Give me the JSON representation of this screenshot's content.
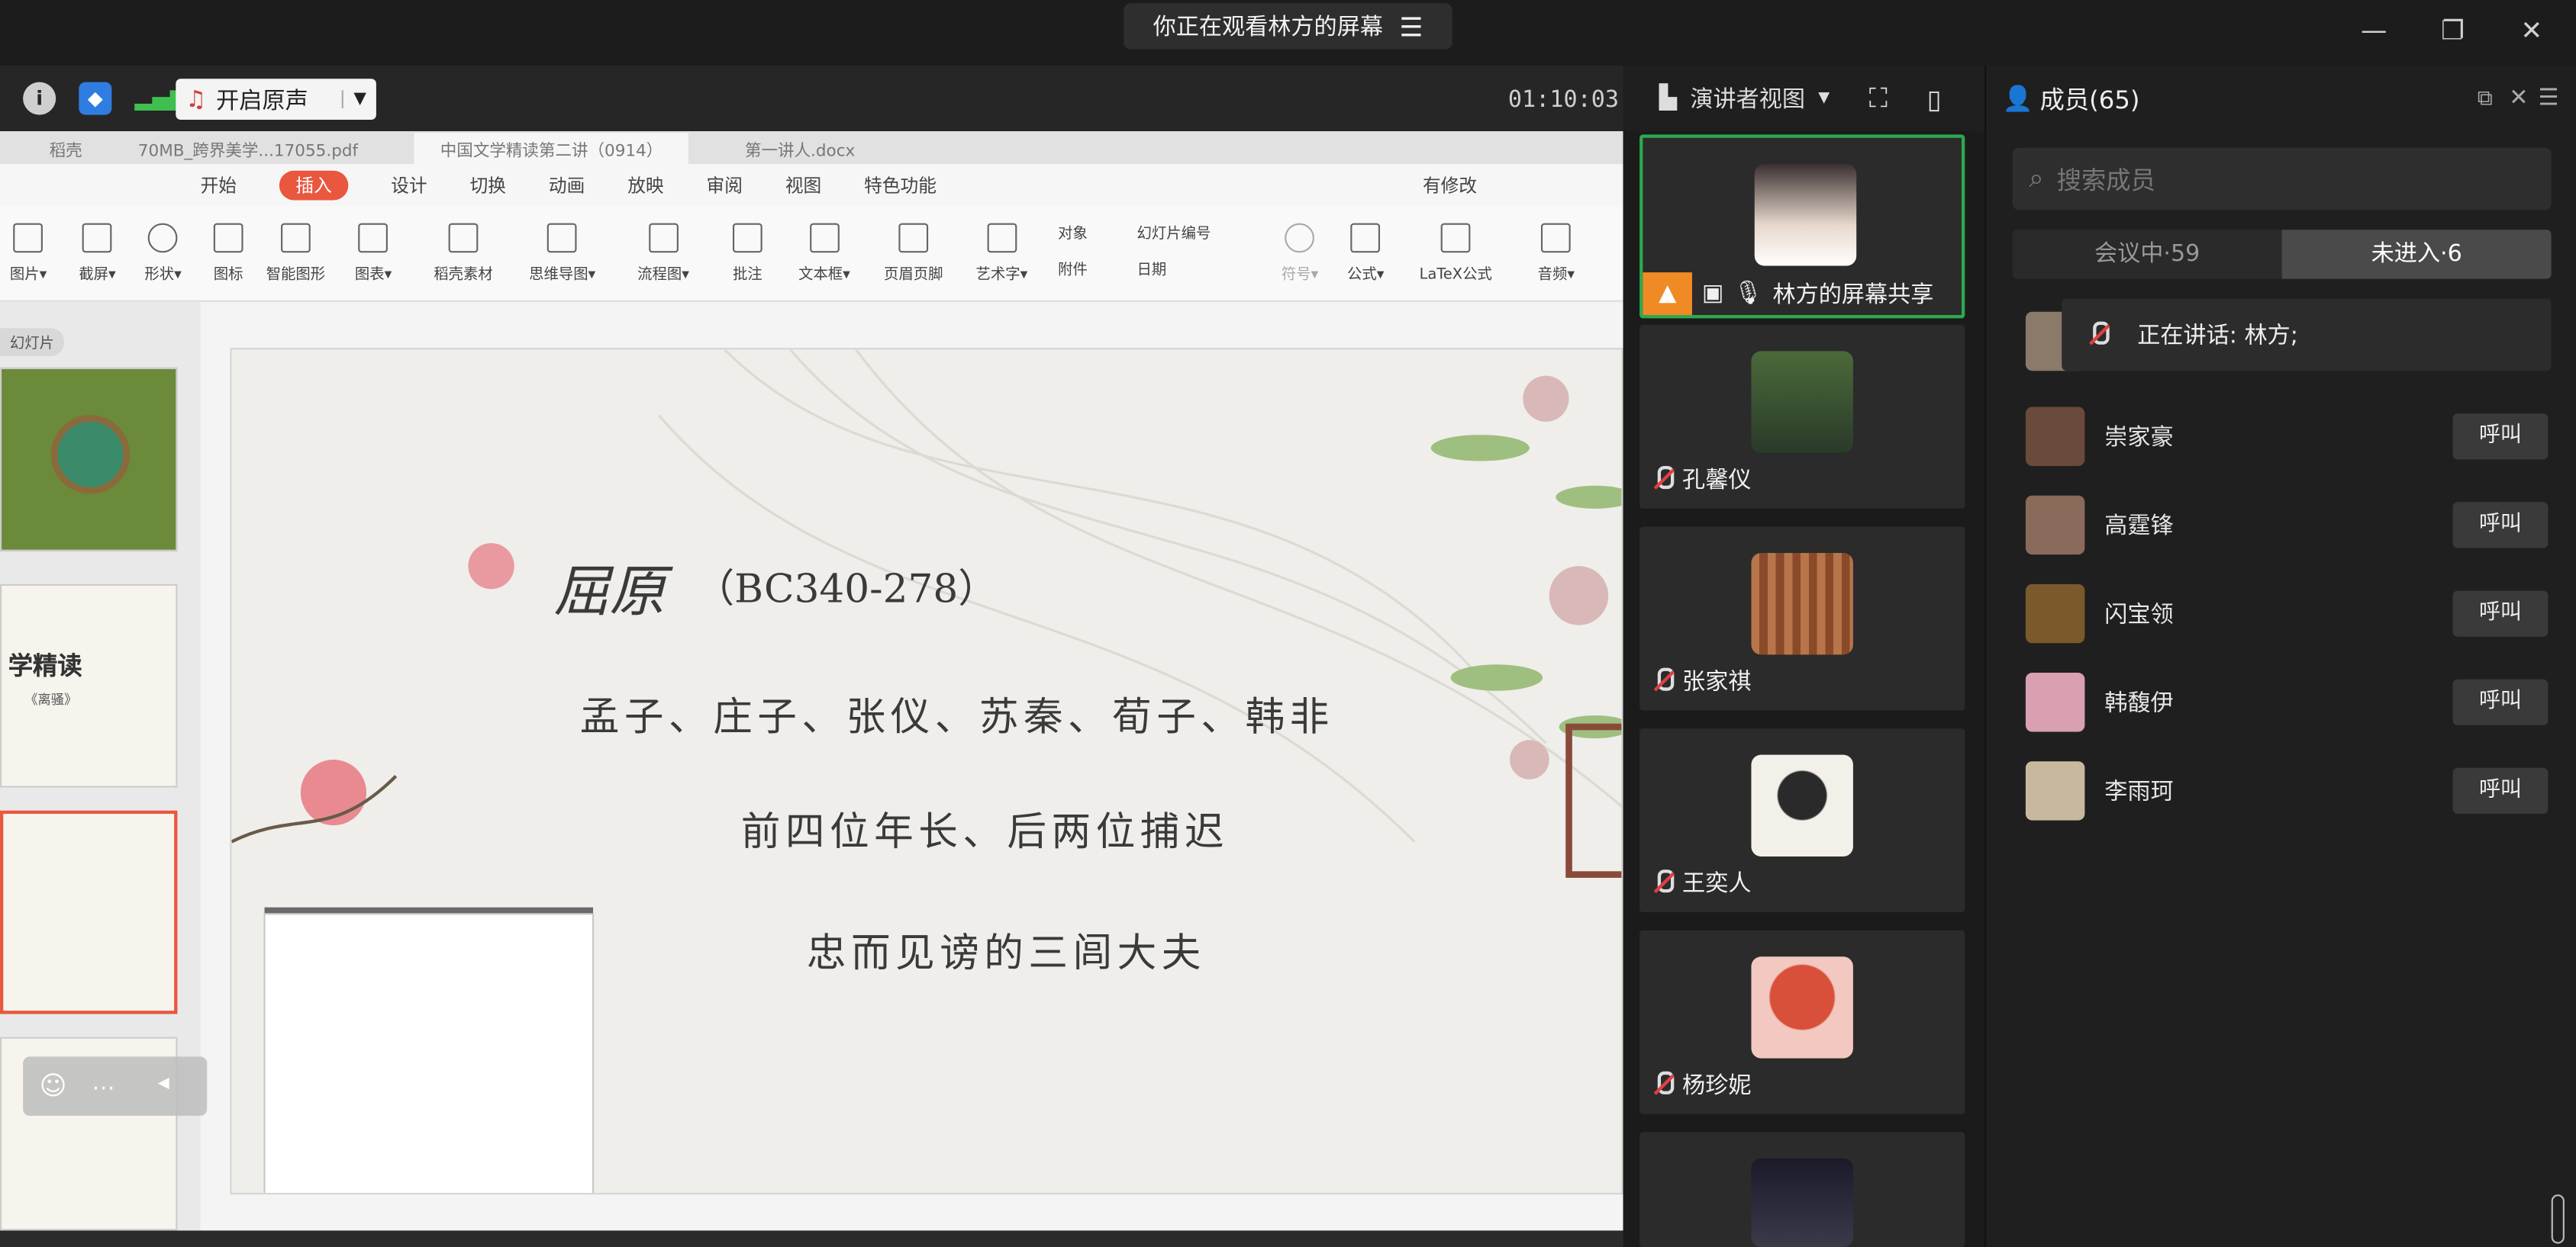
{
  "window": {
    "banner": "你正在观看林方的屏幕",
    "minimize": "—",
    "restore": "❐",
    "close": "✕"
  },
  "toolbar": {
    "sound_label": "开启原声",
    "timer": "01:10:03"
  },
  "app_tabs": [
    "稻壳",
    "70MB_跨界美学...17055.pdf",
    "中国文学精读第二讲（0914）",
    "第一讲人.docx"
  ],
  "ribbon_menu": [
    "开始",
    "插入",
    "设计",
    "切换",
    "动画",
    "放映",
    "审阅",
    "视图",
    "特色功能"
  ],
  "ribbon_menu_active": "插入",
  "ribbon_menu_right": "有修改",
  "ribbon_tools": [
    "图片▾",
    "截屏▾",
    "形状▾",
    "图标",
    "智能图形",
    "图表▾",
    "稻壳素材",
    "思维导图▾",
    "流程图▾",
    "批注",
    "文本框▾",
    "页眉页脚",
    "艺术字▾",
    "对象",
    "附件",
    "幻灯片编号",
    "日期",
    "符号▾",
    "公式▾",
    "LaTeX公式",
    "音频▾"
  ],
  "panel_label": "幻灯片",
  "slide": {
    "title": "屈原",
    "years": "（BC340-278）",
    "line1": "孟子、庄子、张仪、苏秦、荀子、韩非",
    "line2": "前四位年长、后两位捕迟",
    "line3": "忠而见谤的三闾大夫"
  },
  "thumbs": {
    "t2_title": "学精读",
    "t2_sub": "《离骚》"
  },
  "gallery": {
    "view_label": "演讲者视图",
    "presenter": "林方的屏幕共享",
    "participants": [
      "孔馨仪",
      "张家祺",
      "王奕人",
      "杨珍妮"
    ]
  },
  "members": {
    "title": "成员(65)",
    "search_placeholder": "搜索成员",
    "tab_in": "会议中·59",
    "tab_out": "未进入·6",
    "speaking": "正在讲话: 林方;",
    "call_label": "呼叫",
    "list": [
      {
        "name": "崇家豪",
        "color": "#6a4a3a"
      },
      {
        "name": "高霆锋",
        "color": "#8a6a5a"
      },
      {
        "name": "闪宝领",
        "color": "#7a5a2a"
      },
      {
        "name": "韩馥伊",
        "color": "#d8a0b0"
      },
      {
        "name": "李雨珂",
        "color": "#c8b8a0"
      }
    ]
  },
  "colors": {
    "accent": "#e9573f",
    "presenter_border": "#2ea84f",
    "presenter_badge": "#f08a24"
  }
}
